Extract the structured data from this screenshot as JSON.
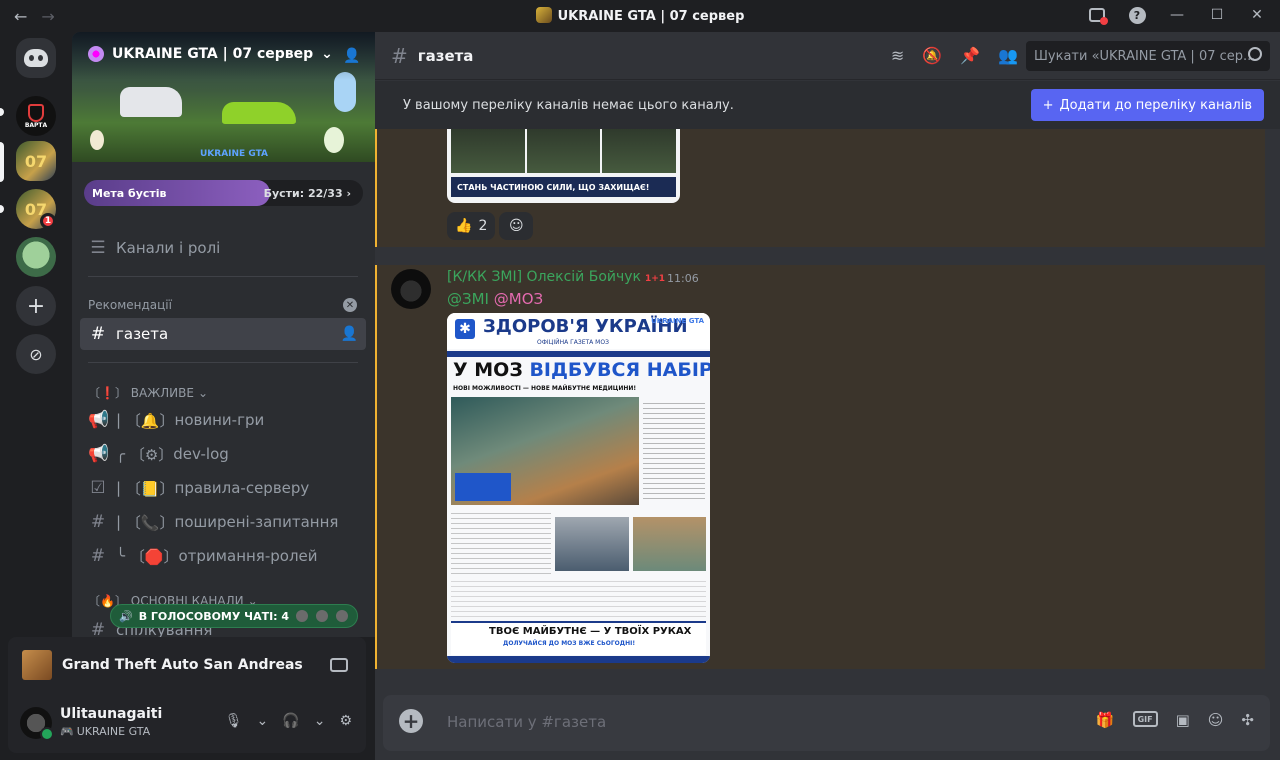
{
  "window": {
    "title": "UKRAINE GTA | 07 сервер",
    "back_icon": "arrow-left-icon",
    "forward_icon": "arrow-right-icon",
    "help_label": "?"
  },
  "rail": {
    "servers": [
      {
        "name": "Discord Home",
        "icon": "discord-icon"
      },
      {
        "name": "ВАРТА",
        "label": "ВАРТА"
      },
      {
        "name": "UKRAINE GTA 07",
        "label": "07"
      },
      {
        "name": "UKRAINE GTA",
        "label": "07",
        "badge": "1"
      },
      {
        "name": "frog server"
      }
    ]
  },
  "server": {
    "name": "UKRAINE GTA | 07 сервер",
    "banner_logo": "UKRAINE GTA",
    "boost_label": "Мета бустів",
    "boost_count": "Бусти: 22/33",
    "boost_progress": 0.667
  },
  "sidebar": {
    "channels_roles": "Канали і ролі",
    "recommend_section": "Рекомендації",
    "active_channel": "газета",
    "section_important": "〔❗〕 ВАЖЛИВЕ",
    "important_channels": [
      {
        "prefix": "|",
        "emoji": "〔🔔〕",
        "name": "новини-гри",
        "icon": "megaphone-icon"
      },
      {
        "prefix": "╭",
        "emoji": "〔⚙〕",
        "name": "dev-log",
        "icon": "megaphone-icon"
      },
      {
        "prefix": "|",
        "emoji": "〔📒〕",
        "name": "правила-серверу",
        "icon": "rules-icon"
      },
      {
        "prefix": "|",
        "emoji": "〔📞〕",
        "name": "поширені-запитання",
        "icon": "hash-icon"
      },
      {
        "prefix": "╰",
        "emoji": "〔🛑〕",
        "name": "отримання-ролей",
        "icon": "hash-icon"
      }
    ],
    "section_main": "〔🔥〕 ОСНОВНІ КАНАЛИ",
    "main_channel": "спілкування",
    "voice_pill": "В ГОЛОСОВОМУ ЧАТІ: 4"
  },
  "activity": {
    "game": "Grand Theft Auto San Andreas"
  },
  "user": {
    "name": "Ulitaunagaiti",
    "status": "UKRAINE GTA"
  },
  "channel": {
    "name": "газета",
    "search_placeholder": "Шукати «UKRAINE GTA | 07 сер...",
    "notice": "У вашому переліку каналів немає цього каналу.",
    "add_button": "Додати до переліку каналів"
  },
  "messages": {
    "prev_image_caption": "СТАНЬ ЧАСТИНОЮ СИЛИ, ЩО ЗАХИЩАЄ!",
    "reaction_emoji": "👍",
    "reaction_count": "2",
    "author": "[К/КК ЗМІ] Олексій Бойчук",
    "author_tag": "1+1",
    "time": "11:06",
    "mention1": "@ЗМІ",
    "mention2": "@МОЗ",
    "paper": {
      "masthead": "ЗДОРОВ'Я УКРАЇНИ",
      "subtitle": "ОФІЦІЙНА ГАЗЕТА МОЗ",
      "logo": "UKRAINE GTA",
      "headline_a": "У МОЗ",
      "headline_b": "ВІДБУВСЯ НАБІР!",
      "tagline": "НОВІ МОЖЛИВОСТІ — НОВЕ МАЙБУТНЄ МЕДИЦИНИ!",
      "footer_title": "ТВОЄ МАЙБУТНЄ — У ТВОЇХ РУКАХ",
      "footer_sub": "ДОЛУЧАЙСЯ ДО МОЗ ВЖЕ СЬОГОДНІ!"
    }
  },
  "composer": {
    "placeholder": "Написати у #газета",
    "gif": "GIF"
  },
  "colors": {
    "accent": "#5865f2",
    "online": "#23a55a",
    "mention_highlight": "#f0b232",
    "author": "#3ba55d"
  }
}
